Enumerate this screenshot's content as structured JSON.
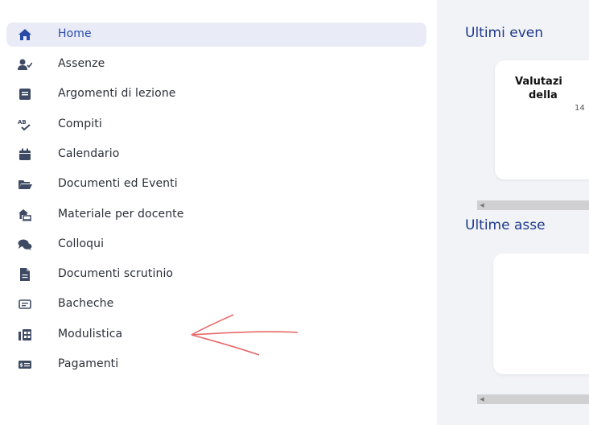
{
  "sidebar": {
    "items": [
      {
        "label": "Home",
        "icon": "home-icon",
        "active": true
      },
      {
        "label": "Assenze",
        "icon": "user-check-icon"
      },
      {
        "label": "Argomenti di lezione",
        "icon": "book-icon"
      },
      {
        "label": "Compiti",
        "icon": "spell-check-icon"
      },
      {
        "label": "Calendario",
        "icon": "calendar-icon"
      },
      {
        "label": "Documenti ed Eventi",
        "icon": "folder-open-icon"
      },
      {
        "label": "Materiale per docente",
        "icon": "house-laptop-icon"
      },
      {
        "label": "Colloqui",
        "icon": "comments-icon"
      },
      {
        "label": "Documenti scrutinio",
        "icon": "file-icon"
      },
      {
        "label": "Bacheche",
        "icon": "board-icon"
      },
      {
        "label": "Modulistica",
        "icon": "forms-icon"
      },
      {
        "label": "Pagamenti",
        "icon": "money-bill-icon"
      }
    ]
  },
  "main": {
    "events_title": "Ultimi even",
    "event_card": {
      "title_line1": "Valutazi",
      "title_line2": "della",
      "date": "14"
    },
    "absences_title": "Ultime asse"
  },
  "colors": {
    "accent": "#1d3a8a",
    "icon": "#3e4a63",
    "active_bg": "#e9ecf7",
    "annotation_arrow": "#e86a6a"
  }
}
